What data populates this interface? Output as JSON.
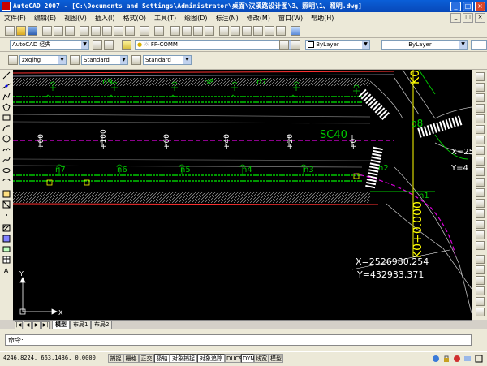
{
  "window": {
    "title": "AutoCAD 2007 - [C:\\Documents and Settings\\Administrator\\桌面\\汉溪路设计图\\3、照明\\1、照明.dwg]",
    "buttons": [
      "_",
      "□",
      "×"
    ]
  },
  "menu": {
    "items": [
      "文件(F)",
      "编辑(E)",
      "视图(V)",
      "插入(I)",
      "格式(O)",
      "工具(T)",
      "绘图(D)",
      "标注(N)",
      "修改(M)",
      "窗口(W)",
      "帮助(H)"
    ],
    "mdi_buttons": [
      "_",
      "□",
      "×"
    ]
  },
  "toolbar2": {
    "workspace": "AutoCAD 经典",
    "layer": "FP-COMM",
    "color": "ByLayer",
    "linetype": "ByLayer",
    "lineweight": "ByLayer"
  },
  "toolbar3": {
    "text_style": "zxqjhg",
    "dim_style": "Standard",
    "table_style": "Standard"
  },
  "drawing": {
    "labels": {
      "k0_top": "K0",
      "k0_bottom": "K0+0.000",
      "sc": "SC40",
      "p8": "p8",
      "x_top": "X=25",
      "y_top": "Y=4",
      "x_bottom": "X=2526980.254",
      "y_bottom": "Y=432933.371",
      "ucs_x": "X",
      "ucs_y": "Y",
      "stations": [
        "+60",
        "+100",
        "+60",
        "+40",
        "+20",
        "+0"
      ],
      "lamps_top": [
        "n9",
        "n8",
        "n7"
      ],
      "lamps_bottom": [
        "n7",
        "n6",
        "n5",
        "n4",
        "n3",
        "n2",
        "n1"
      ]
    },
    "colors": {
      "background": "#000000",
      "road_green": "#00c800",
      "pink": "#e000e0",
      "yellow": "#ffff00",
      "white": "#ffffff",
      "red": "#ff3030"
    }
  },
  "tabs": {
    "nav": [
      "|◀",
      "◀",
      "▶",
      "▶|"
    ],
    "items": [
      "模型",
      "布局1",
      "布局2"
    ]
  },
  "command": {
    "prompt": "命令:"
  },
  "status": {
    "coords": "4246.8224, 663.1486, 0.0000",
    "buttons": [
      "捕捉",
      "栅格",
      "正交",
      "极轴",
      "对象捕捉",
      "对象追踪",
      "DUCS",
      "DYN",
      "线宽",
      "模型"
    ]
  }
}
